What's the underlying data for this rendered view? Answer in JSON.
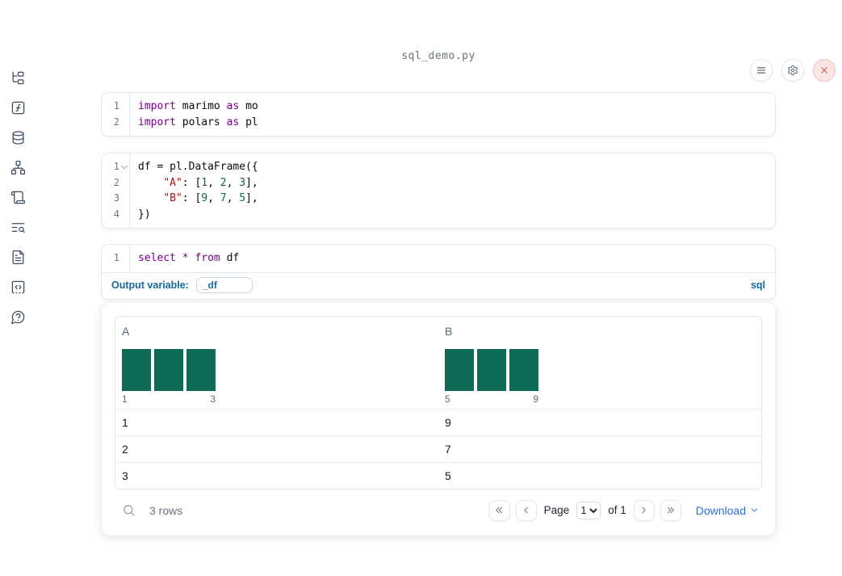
{
  "title": "sql_demo.py",
  "topbar": {
    "buttons": [
      {
        "name": "menu",
        "icon": "menu"
      },
      {
        "name": "settings",
        "icon": "gear"
      },
      {
        "name": "close",
        "icon": "x"
      }
    ]
  },
  "sidebar": {
    "items": [
      {
        "name": "file-explorer",
        "icon": "file-tree"
      },
      {
        "name": "variables",
        "icon": "function-square"
      },
      {
        "name": "datasources",
        "icon": "database"
      },
      {
        "name": "dependencies",
        "icon": "network"
      },
      {
        "name": "logs",
        "icon": "scroll"
      },
      {
        "name": "outline",
        "icon": "text-search"
      },
      {
        "name": "documentation",
        "icon": "file-text"
      },
      {
        "name": "snippets",
        "icon": "code-square"
      },
      {
        "name": "help",
        "icon": "help-bubble"
      }
    ]
  },
  "cells": [
    {
      "id": "cell1",
      "lines": [
        {
          "num": "1",
          "fold": false,
          "tokens": [
            [
              "kw",
              "import"
            ],
            [
              "pl",
              " marimo "
            ],
            [
              "kw",
              "as"
            ],
            [
              "pl",
              " mo"
            ]
          ]
        },
        {
          "num": "2",
          "fold": false,
          "tokens": [
            [
              "kw",
              "import"
            ],
            [
              "pl",
              " polars "
            ],
            [
              "kw",
              "as"
            ],
            [
              "pl",
              " pl"
            ]
          ]
        }
      ]
    },
    {
      "id": "cell2",
      "lines": [
        {
          "num": "1",
          "fold": true,
          "tokens": [
            [
              "pl",
              "df = pl.DataFrame({"
            ]
          ]
        },
        {
          "num": "2",
          "fold": false,
          "tokens": [
            [
              "pl",
              "    "
            ],
            [
              "str",
              "\"A\""
            ],
            [
              "pl",
              ": ["
            ],
            [
              "num",
              "1"
            ],
            [
              "pl",
              ", "
            ],
            [
              "num",
              "2"
            ],
            [
              "pl",
              ", "
            ],
            [
              "num",
              "3"
            ],
            [
              "pl",
              "],"
            ]
          ]
        },
        {
          "num": "3",
          "fold": false,
          "tokens": [
            [
              "pl",
              "    "
            ],
            [
              "str",
              "\"B\""
            ],
            [
              "pl",
              ": ["
            ],
            [
              "num",
              "9"
            ],
            [
              "pl",
              ", "
            ],
            [
              "num",
              "7"
            ],
            [
              "pl",
              ", "
            ],
            [
              "num",
              "5"
            ],
            [
              "pl",
              "],"
            ]
          ]
        },
        {
          "num": "4",
          "fold": false,
          "tokens": [
            [
              "pl",
              "})"
            ]
          ]
        }
      ]
    },
    {
      "id": "cell3",
      "lines": [
        {
          "num": "1",
          "fold": false,
          "tokens": [
            [
              "kw",
              "select"
            ],
            [
              "pl",
              " "
            ],
            [
              "kw",
              "*"
            ],
            [
              "pl",
              " "
            ],
            [
              "kw",
              "from"
            ],
            [
              "pl",
              " df"
            ]
          ]
        }
      ]
    }
  ],
  "sql_cell": {
    "output_variable_label": "Output variable:",
    "output_variable_value": "_df",
    "language_label": "sql"
  },
  "table": {
    "columns": [
      {
        "name": "A",
        "histogram": {
          "bar_count": 3,
          "min_label": "1",
          "max_label": "3",
          "values": [
            1,
            2,
            3
          ]
        }
      },
      {
        "name": "B",
        "histogram": {
          "bar_count": 3,
          "min_label": "5",
          "max_label": "9",
          "values": [
            9,
            7,
            5
          ]
        }
      }
    ],
    "rows": [
      [
        "1",
        "9"
      ],
      [
        "2",
        "7"
      ],
      [
        "3",
        "5"
      ]
    ],
    "footer": {
      "row_count": "3 rows",
      "page_label": "Page",
      "page_value": "1",
      "of_label": "of 1",
      "download_label": "Download"
    }
  },
  "colors": {
    "accent_blue": "#15699e",
    "link_blue": "#2671d9",
    "histogram_green": "#0e6a57",
    "keyword_purple": "#770088",
    "string_red": "#aa1111",
    "number_green": "#116644",
    "close_red": "#d85f5f"
  }
}
